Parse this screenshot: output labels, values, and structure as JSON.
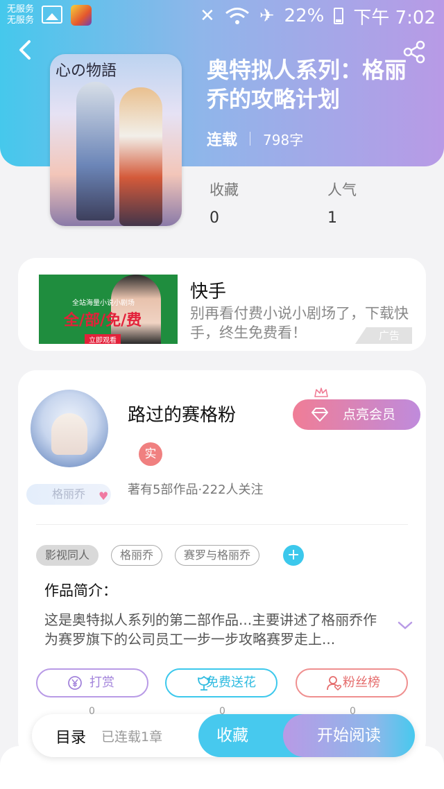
{
  "statusbar": {
    "carrier_line1": "无服务",
    "carrier_line2": "无服务",
    "battery": "22%",
    "time": "下午 7:02"
  },
  "book": {
    "cover_title": "心の物語",
    "title": "奥特拟人系列：格丽乔的攻略计划",
    "status": "连载",
    "words": "798字",
    "favorites_label": "收藏",
    "favorites_value": "0",
    "popularity_label": "人气",
    "popularity_value": "1"
  },
  "ad": {
    "title": "快手",
    "description": "别再看付费小说小剧场了，下载快手，终生免费看！",
    "tag": "广告",
    "image_small": "全站海量小说小剧场",
    "image_slogan": "全/部/免/费",
    "image_watch": "立即观看"
  },
  "author": {
    "name": "路过的赛格粉",
    "real_badge": "实",
    "fan_badge": "格丽乔",
    "stats": "著有5部作品·222人关注",
    "vip_label": "点亮会员"
  },
  "tags": [
    "影视同人",
    "格丽乔",
    "赛罗与格丽乔"
  ],
  "intro": {
    "title": "作品简介：",
    "text": "这是奥特拟人系列的第二部作品...主要讲述了格丽乔作为赛罗旗下的公司员工一步一步攻略赛罗走上..."
  },
  "actions": {
    "reward_label": "打赏",
    "reward_count": "0",
    "flower_label": "免费送花",
    "flower_count": "0",
    "fans_label": "粉丝榜",
    "fans_count": "0"
  },
  "bottom": {
    "toc_label": "目录",
    "toc_count": "已连载1章",
    "favorite_button": "收藏",
    "read_button": "开始阅读"
  },
  "colors": {
    "accent_cyan": "#47c9ee",
    "accent_purple": "#b89ae6",
    "accent_pink": "#f07d96"
  }
}
